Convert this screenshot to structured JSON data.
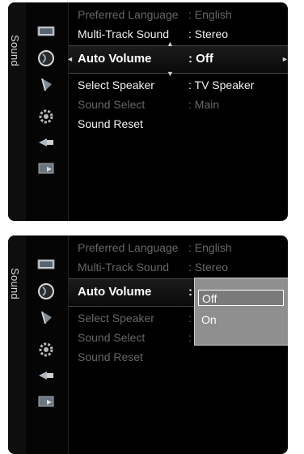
{
  "panel1": {
    "tab_label": "Sound",
    "items": [
      {
        "label": "Preferred Language",
        "value": ": English"
      },
      {
        "label": "Multi-Track Sound",
        "value": ": Stereo"
      },
      {
        "label": "Auto Volume",
        "value": ": Off"
      },
      {
        "label": "Select Speaker",
        "value": ": TV Speaker"
      },
      {
        "label": "Sound Select",
        "value": ": Main"
      },
      {
        "label": "Sound Reset",
        "value": ""
      }
    ]
  },
  "panel2": {
    "tab_label": "Sound",
    "items": [
      {
        "label": "Preferred Language",
        "value": ": English"
      },
      {
        "label": "Multi-Track Sound",
        "value": ": Stereo"
      },
      {
        "label": "Auto Volume",
        "value": ":"
      },
      {
        "label": "Select Speaker",
        "value": ":"
      },
      {
        "label": "Sound Select",
        "value": ":"
      },
      {
        "label": "Sound Reset",
        "value": ""
      }
    ],
    "dropdown": {
      "options": [
        "Off",
        "On"
      ],
      "selected": "Off"
    }
  },
  "icons": [
    "picture-icon",
    "sound-icon",
    "channel-icon",
    "setup-icon",
    "input-icon",
    "application-icon"
  ],
  "colors": {
    "background": "#000000",
    "dim_text": "#676767",
    "bright_text": "#f2f2f2",
    "popup": "#8f8f8f"
  }
}
